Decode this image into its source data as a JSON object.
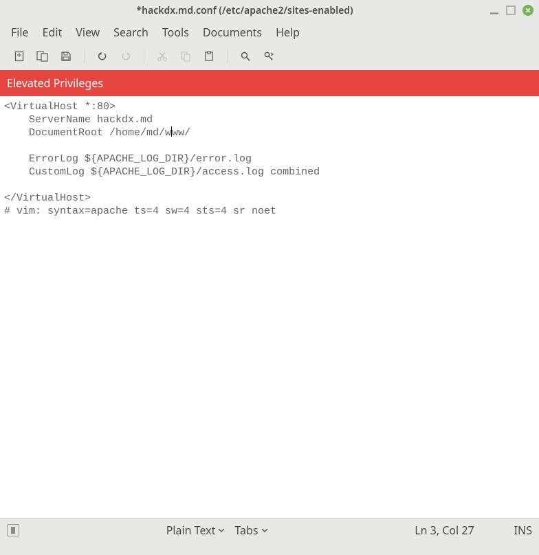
{
  "title": "*hackdx.md.conf (/etc/apache2/sites-enabled)",
  "menu": {
    "file": "File",
    "edit": "Edit",
    "view": "View",
    "search": "Search",
    "tools": "Tools",
    "documents": "Documents",
    "help": "Help"
  },
  "banner": "Elevated Privileges",
  "editor_lines": [
    "<VirtualHost *:80>",
    "    ServerName hackdx.md",
    "    DocumentRoot /home/md/www/",
    "",
    "    ErrorLog ${APACHE_LOG_DIR}/error.log",
    "    CustomLog ${APACHE_LOG_DIR}/access.log combined",
    "",
    "</VirtualHost>",
    "# vim: syntax=apache ts=4 sw=4 sts=4 sr noet"
  ],
  "cursor": {
    "line": 2,
    "col": 27
  },
  "status": {
    "syntax": "Plain Text",
    "indent": "Tabs",
    "pos": "Ln 3, Col 27",
    "mode": "INS"
  }
}
